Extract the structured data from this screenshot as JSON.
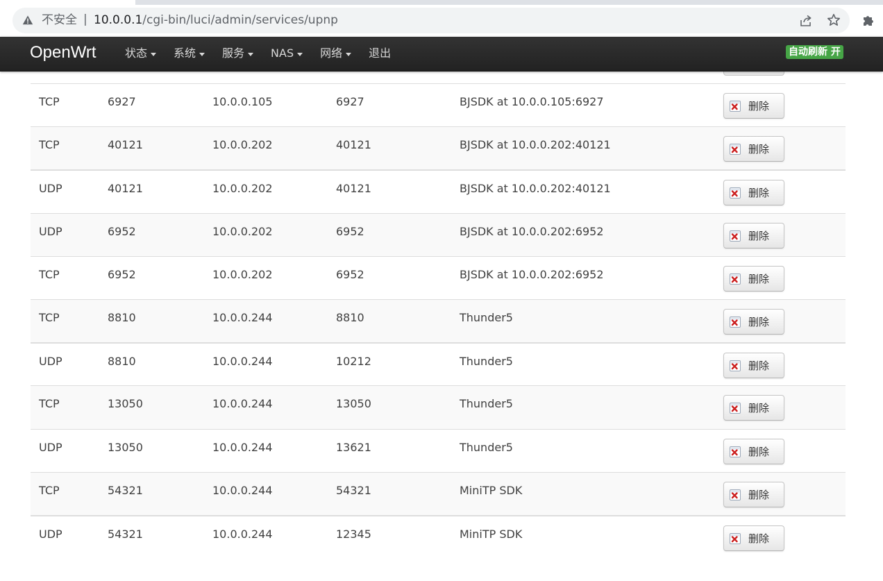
{
  "browser": {
    "security_label": "不安全",
    "separator": "|",
    "url_host": "10.0.0.1",
    "url_path": "/cgi-bin/luci/admin/services/upnp"
  },
  "navbar": {
    "brand": "OpenWrt",
    "menu": [
      {
        "label": "状态",
        "dropdown": true
      },
      {
        "label": "系统",
        "dropdown": true
      },
      {
        "label": "服务",
        "dropdown": true
      },
      {
        "label": "NAS",
        "dropdown": true
      },
      {
        "label": "网络",
        "dropdown": true
      },
      {
        "label": "退出",
        "dropdown": false
      }
    ],
    "autorefresh": "自动刷新 开"
  },
  "colors": {
    "navbar_bg": "#222222",
    "autorefresh_bg": "#46a546",
    "delete_icon": "#cc1f1f"
  },
  "delete_label": "删除",
  "rows": [
    {
      "protocol": "TCP",
      "ext_port": "6927",
      "client": "10.0.0.105",
      "int_port": "6927",
      "description": "BJSDK at 10.0.0.105:6927"
    },
    {
      "protocol": "TCP",
      "ext_port": "40121",
      "client": "10.0.0.202",
      "int_port": "40121",
      "description": "BJSDK at 10.0.0.202:40121"
    },
    {
      "protocol": "UDP",
      "ext_port": "40121",
      "client": "10.0.0.202",
      "int_port": "40121",
      "description": "BJSDK at 10.0.0.202:40121"
    },
    {
      "protocol": "UDP",
      "ext_port": "6952",
      "client": "10.0.0.202",
      "int_port": "6952",
      "description": "BJSDK at 10.0.0.202:6952"
    },
    {
      "protocol": "TCP",
      "ext_port": "6952",
      "client": "10.0.0.202",
      "int_port": "6952",
      "description": "BJSDK at 10.0.0.202:6952"
    },
    {
      "protocol": "TCP",
      "ext_port": "8810",
      "client": "10.0.0.244",
      "int_port": "8810",
      "description": "Thunder5"
    },
    {
      "protocol": "UDP",
      "ext_port": "8810",
      "client": "10.0.0.244",
      "int_port": "10212",
      "description": "Thunder5"
    },
    {
      "protocol": "TCP",
      "ext_port": "13050",
      "client": "10.0.0.244",
      "int_port": "13050",
      "description": "Thunder5"
    },
    {
      "protocol": "UDP",
      "ext_port": "13050",
      "client": "10.0.0.244",
      "int_port": "13621",
      "description": "Thunder5"
    },
    {
      "protocol": "TCP",
      "ext_port": "54321",
      "client": "10.0.0.244",
      "int_port": "54321",
      "description": "MiniTP SDK"
    },
    {
      "protocol": "UDP",
      "ext_port": "54321",
      "client": "10.0.0.244",
      "int_port": "12345",
      "description": "MiniTP SDK"
    }
  ]
}
